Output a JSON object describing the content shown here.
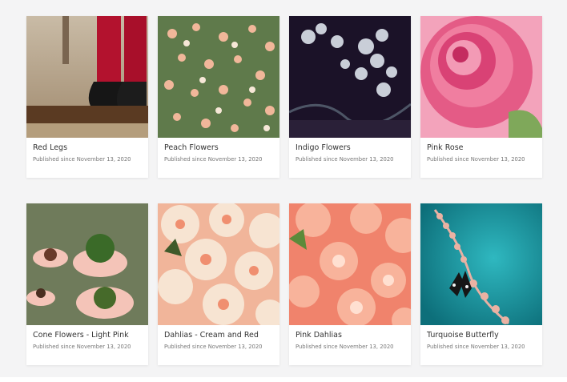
{
  "gallery": {
    "published_prefix": "Published since",
    "cards": [
      {
        "title": "Red Legs",
        "published": "Published since November 13, 2020",
        "image": "photo-legs-shoes"
      },
      {
        "title": "Peach Flowers",
        "published": "Published since November 13, 2020",
        "image": "photo-peach-flowers"
      },
      {
        "title": "Indigo Flowers",
        "published": "Published since November 13, 2020",
        "image": "photo-indigo-flowers"
      },
      {
        "title": "Pink Rose",
        "published": "Published since November 13, 2020",
        "image": "photo-pink-rose"
      },
      {
        "title": "Cone Flowers - Light Pink",
        "published": "Published since November 13, 2020",
        "image": "photo-cone-flowers"
      },
      {
        "title": "Dahlias - Cream and Red",
        "published": "Published since November 13, 2020",
        "image": "photo-cream-dahlias"
      },
      {
        "title": "Pink Dahlias",
        "published": "Published since November 13, 2020",
        "image": "photo-pink-dahlias"
      },
      {
        "title": "Turquoise Butterfly",
        "published": "Published since November 13, 2020",
        "image": "photo-turquoise-butterfly"
      }
    ]
  }
}
